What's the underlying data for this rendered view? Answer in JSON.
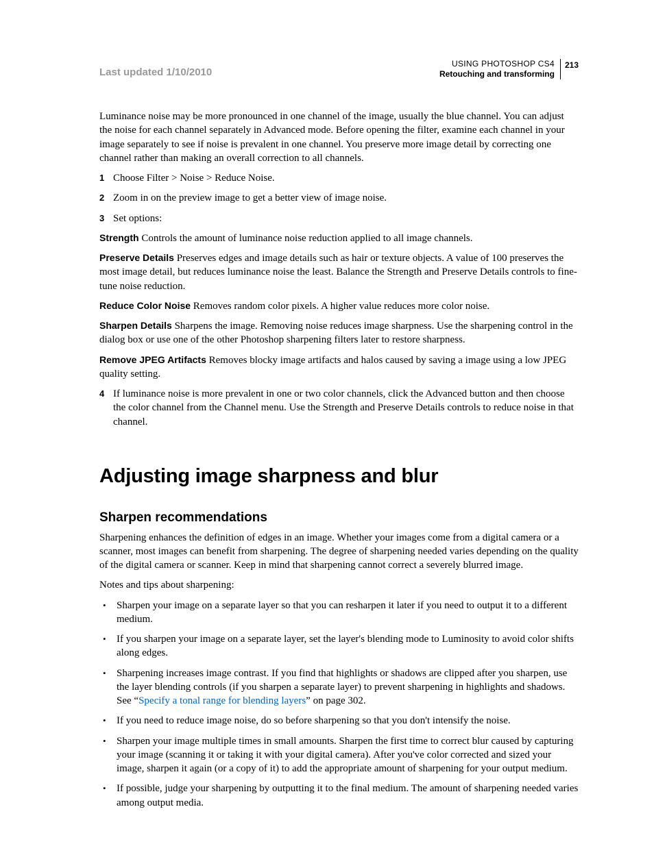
{
  "header": {
    "updated": "Last updated 1/10/2010",
    "doc_title": "USING PHOTOSHOP CS4",
    "section": "Retouching and transforming",
    "page_num": "213"
  },
  "intro_para": "Luminance noise may be more pronounced in one channel of the image, usually the blue channel. You can adjust the noise for each channel separately in Advanced mode. Before opening the filter, examine each channel in your image separately to see if noise is prevalent in one channel. You preserve more image detail by correcting one channel rather than making an overall correction to all channels.",
  "steps": {
    "s1": {
      "num": "1",
      "text": "Choose Filter > Noise > Reduce Noise."
    },
    "s2": {
      "num": "2",
      "text": "Zoom in on the preview image to get a better view of image noise."
    },
    "s3": {
      "num": "3",
      "text": "Set options:"
    },
    "s4": {
      "num": "4",
      "text": "If luminance noise is more prevalent in one or two color channels, click the Advanced button and then choose the color channel from the Channel menu. Use the Strength and Preserve Details controls to reduce noise in that channel."
    }
  },
  "defs": {
    "strength": {
      "term": "Strength",
      "text": "  Controls the amount of luminance noise reduction applied to all image channels."
    },
    "preserve": {
      "term": "Preserve Details",
      "text": "  Preserves edges and image details such as hair or texture objects. A value of 100 preserves the most image detail, but reduces luminance noise the least. Balance the Strength and Preserve Details controls to fine-tune noise reduction."
    },
    "reduce": {
      "term": "Reduce Color Noise",
      "text": "  Removes random color pixels. A higher value reduces more color noise."
    },
    "sharpen": {
      "term": "Sharpen Details",
      "text": "  Sharpens the image. Removing noise reduces image sharpness. Use the sharpening control in the dialog box or use one of the other Photoshop sharpening filters later to restore sharpness."
    },
    "jpeg": {
      "term": "Remove JPEG Artifacts",
      "text": "  Removes blocky image artifacts and halos caused by saving a image using a low JPEG quality setting."
    }
  },
  "section2": {
    "h1": "Adjusting image sharpness and blur",
    "h2": "Sharpen recommendations",
    "p1": "Sharpening enhances the definition of edges in an image. Whether your images come from a digital camera or a scanner, most images can benefit from sharpening. The degree of sharpening needed varies depending on the quality of the digital camera or scanner. Keep in mind that sharpening cannot correct a severely blurred image.",
    "p2": "Notes and tips about sharpening:",
    "bullets": {
      "b1": "Sharpen your image on a separate layer so that you can resharpen it later if you need to output it to a different medium.",
      "b2": "If you sharpen your image on a separate layer, set the layer's blending mode to Luminosity to avoid color shifts along edges.",
      "b3_pre": "Sharpening increases image contrast. If you find that highlights or shadows are clipped after you sharpen, use the layer blending controls (if you sharpen a separate layer) to prevent sharpening in highlights and shadows. See “",
      "b3_link": "Specify a tonal range for blending layers",
      "b3_post": "” on page 302.",
      "b4": "If you need to reduce image noise, do so before sharpening so that you don't intensify the noise.",
      "b5": "Sharpen your image multiple times in small amounts. Sharpen the first time to correct blur caused by capturing your image (scanning it or taking it with your digital camera). After you've color corrected and sized your image, sharpen it again (or a copy of it) to add the appropriate amount of sharpening for your output medium.",
      "b6": "If possible, judge your sharpening by outputting it to the final medium. The amount of sharpening needed varies among output media."
    }
  }
}
